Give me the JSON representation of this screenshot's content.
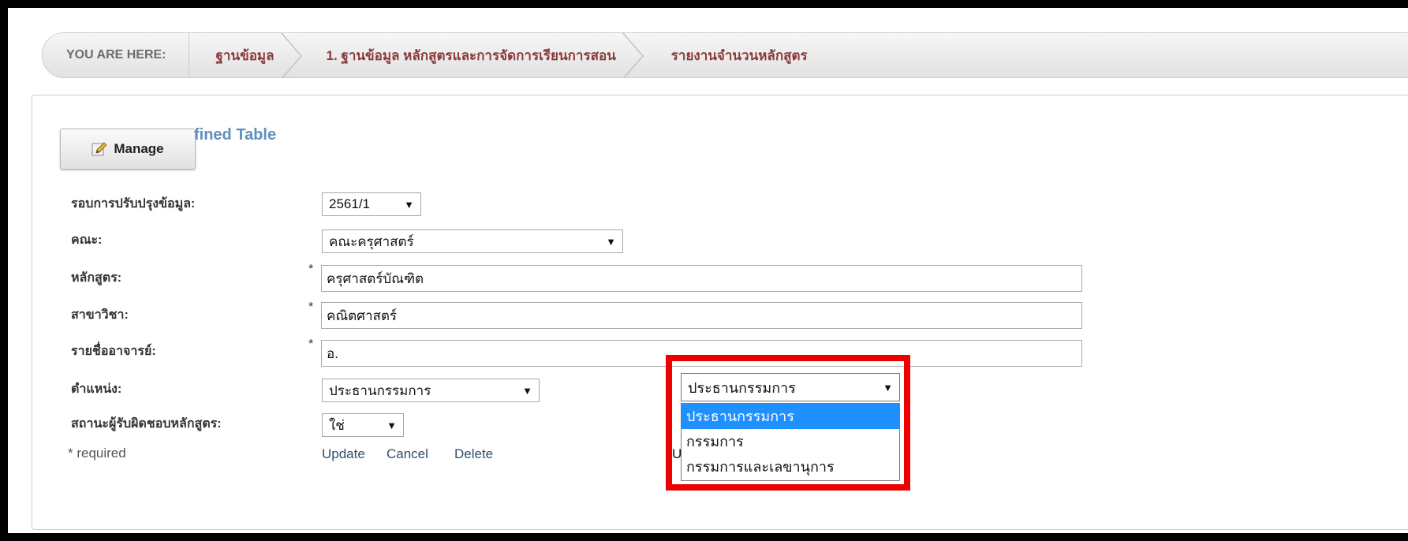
{
  "breadcrumb": {
    "label": "YOU ARE HERE:",
    "items": [
      "ฐานข้อมูล",
      "1. ฐานข้อมูล หลักสูตรและการจัดการเรียนการสอน",
      "รายงานจำนวนหลักสูตร"
    ]
  },
  "toolbar": {
    "manage_label": "Manage",
    "title_fragment": "fined Table"
  },
  "form": {
    "round": {
      "label": "รอบการปรับปรุงข้อมูล:",
      "value": "2561/1"
    },
    "faculty": {
      "label": "คณะ:",
      "value": "คณะครุศาสตร์"
    },
    "program": {
      "label": "หลักสูตร:",
      "value": "ครุศาสตร์บัณฑิต"
    },
    "major": {
      "label": "สาขาวิชา:",
      "value": "คณิตศาสตร์"
    },
    "instructor": {
      "label": "รายชื่ออาจารย์:",
      "value": "อ."
    },
    "position": {
      "label": "ตำแหน่ง:",
      "value": "ประธานกรรมการ"
    },
    "responsible": {
      "label": "สถานะผู้รับผิดชอบหลักสูตร:",
      "value": "ใช่"
    },
    "required_star": "*",
    "required_note": "* required"
  },
  "actions": {
    "update": "Update",
    "cancel": "Cancel",
    "delete": "Delete"
  },
  "dropdown": {
    "selected": "ประธานกรรมการ",
    "options": [
      "ประธานกรรมการ",
      "กรรมการ",
      "กรรมการและเลขานุการ"
    ],
    "behind_char": "U"
  },
  "colors": {
    "highlight": "#ee0000",
    "option_selected": "#1e90ff",
    "breadcrumb_link": "#8b3a3a",
    "title": "#5e8fc0"
  },
  "icons": {
    "manage": "pencil-icon",
    "caret": "caret-down-icon"
  }
}
